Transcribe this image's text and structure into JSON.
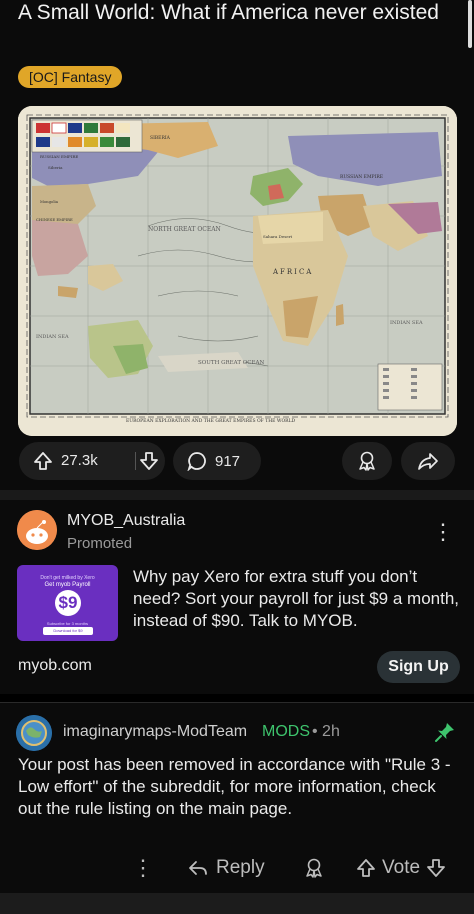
{
  "post": {
    "title": "A Small World: What if America never existed",
    "flair": "[OC] Fantasy",
    "map": {
      "labels": {
        "siberia": "SIBERIA",
        "russian_empire_left": "RUSSIAN EMPIRE",
        "siberia_small": "Siberia",
        "mongolia": "Mongolia",
        "chinese_empire": "CHINESE EMPIRE",
        "north_great_ocean": "NORTH GREAT OCEAN",
        "russian_empire_right": "RUSSIAN EMPIRE",
        "sahara": "Sahara Desert",
        "africa": "AFRICA",
        "indian_sea_left": "INDIAN SEA",
        "indian_sea_right": "INDIAN SEA",
        "south_great_ocean": "SOUTH GREAT OCEAN",
        "caption": "EUROPEAN EXPLORATION AND THE GREAT EMPIRES OF THE WORLD"
      },
      "colors": {
        "paper": "#ece6d4",
        "ocean": "#c8ccc2",
        "russia": "#8f8fb8",
        "china": "#c8a4a0",
        "africa_land": "#d9c79a",
        "green_land": "#8fb36a",
        "tan_land": "#c9a46a"
      }
    },
    "upvotes": "27.3k",
    "comments": "917",
    "icons": {
      "upvote": "upvote-arrow-icon",
      "downvote": "downvote-arrow-icon",
      "comment": "comment-bubble-icon",
      "award": "award-icon",
      "share": "share-arrow-icon"
    }
  },
  "ad": {
    "advertiser": "MYOB_Australia",
    "promoted_label": "Promoted",
    "thumb": {
      "line1": "Don't get milked by Xero",
      "line2": "Get myob Payroll",
      "price": "$9",
      "line3": "Subscribe for 3 months",
      "cta": "Download for $9"
    },
    "body": "Why pay Xero for extra stuff you don’t need? Sort your payroll for just $9 a month, instead of $90. Talk to MYOB.",
    "domain": "myob.com",
    "cta": "Sign Up",
    "brand_color": "#6a2fc0"
  },
  "comment": {
    "author": "imaginarymaps-ModTeam",
    "badge": "MODS",
    "time": "• 2h",
    "body": "Your post has been removed in accordance with \"Rule 3 - Low effort\" of the subreddit, for more information, check out the rule listing on the main page.",
    "actions": {
      "reply": "Reply",
      "vote": "Vote"
    },
    "badge_color": "#3ec46d"
  }
}
